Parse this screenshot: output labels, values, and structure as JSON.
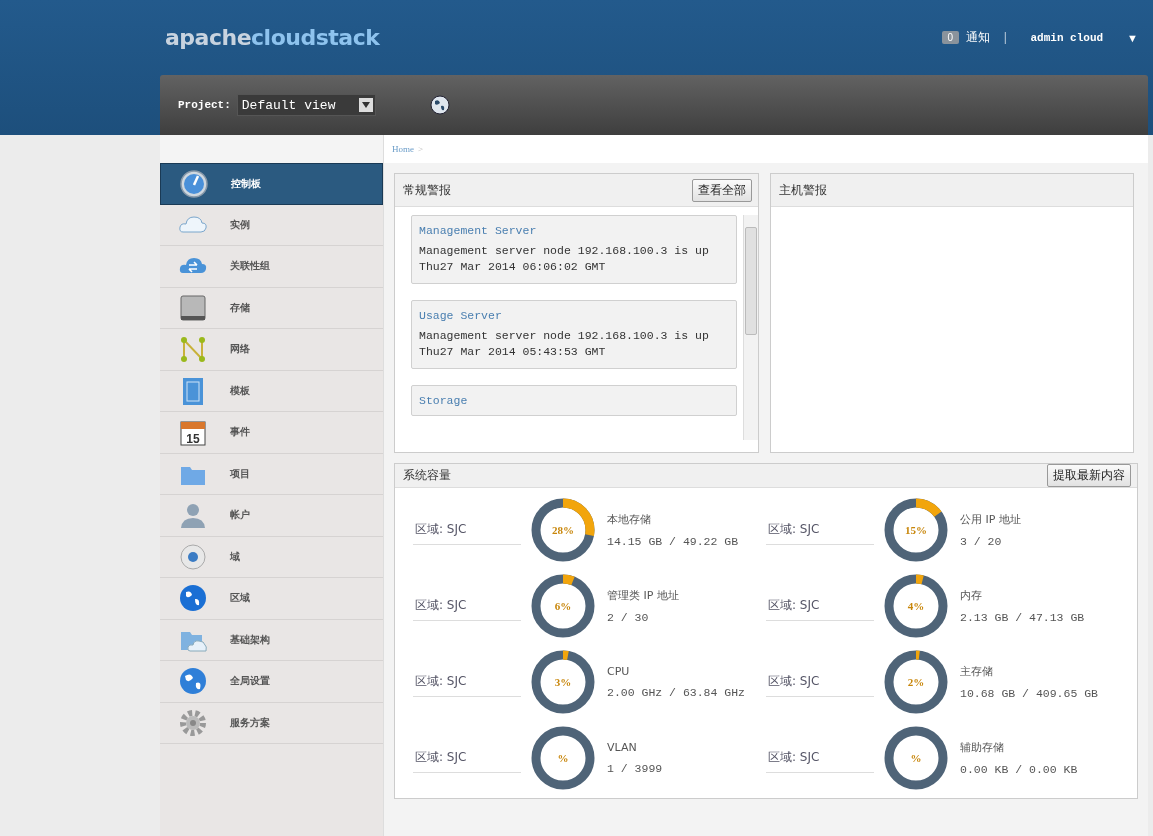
{
  "header": {
    "logo_prefix": "apache",
    "logo_suffix": "cloudstack",
    "notification_count": "0",
    "notification_label": "通知",
    "separator": "|",
    "user": "admin cloud",
    "user_menu_caret": "▼"
  },
  "project_bar": {
    "label": "Project:",
    "value": "Default view"
  },
  "sidebar": {
    "items": [
      {
        "label": "控制板",
        "selected": true
      },
      {
        "label": "实例",
        "selected": false
      },
      {
        "label": "关联性组",
        "selected": false
      },
      {
        "label": "存储",
        "selected": false
      },
      {
        "label": "网络",
        "selected": false
      },
      {
        "label": "模板",
        "selected": false
      },
      {
        "label": "事件",
        "selected": false,
        "icon_text": "15"
      },
      {
        "label": "项目",
        "selected": false
      },
      {
        "label": "帐户",
        "selected": false
      },
      {
        "label": "域",
        "selected": false
      },
      {
        "label": "区域",
        "selected": false
      },
      {
        "label": "基础架构",
        "selected": false
      },
      {
        "label": "全局设置",
        "selected": false
      },
      {
        "label": "服务方案",
        "selected": false
      }
    ]
  },
  "breadcrumb": {
    "home": "Home",
    "separator": ">"
  },
  "general_alerts": {
    "title": "常规警报",
    "button": "查看全部",
    "alerts": [
      {
        "title": "Management Server",
        "message": "Management server node 192.168.100.3 is up",
        "time": "Thu27 Mar 2014 06:06:02 GMT"
      },
      {
        "title": "Usage Server",
        "message": "Management server node 192.168.100.3 is up",
        "time": "Thu27 Mar 2014 05:43:53 GMT"
      },
      {
        "title": "Storage"
      }
    ]
  },
  "host_alerts": {
    "title": "主机警报"
  },
  "capacity": {
    "title": "系统容量",
    "button": "提取最新内容",
    "items": [
      {
        "zone": "区域: SJC",
        "percent": "28%",
        "level": 0.28,
        "name": "本地存储",
        "usage": "14.15 GB / 49.22 GB"
      },
      {
        "zone": "区域: SJC",
        "percent": "15%",
        "level": 0.15,
        "name": "公用 IP 地址",
        "usage": "3 / 20"
      },
      {
        "zone": "区域: SJC",
        "percent": "6%",
        "level": 0.06,
        "name": "管理类 IP 地址",
        "usage": "2 / 30"
      },
      {
        "zone": "区域: SJC",
        "percent": "4%",
        "level": 0.04,
        "name": "内存",
        "usage": "2.13 GB / 47.13 GB"
      },
      {
        "zone": "区域: SJC",
        "percent": "3%",
        "level": 0.03,
        "name": "CPU",
        "usage": "2.00 GHz / 63.84 GHz"
      },
      {
        "zone": "区域: SJC",
        "percent": "2%",
        "level": 0.02,
        "name": "主存储",
        "usage": "10.68 GB / 409.65 GB"
      },
      {
        "zone": "区域: SJC",
        "percent": "%",
        "level": 0,
        "name": "VLAN",
        "usage": "1 / 3999"
      },
      {
        "zone": "区域: SJC",
        "percent": "%",
        "level": 0,
        "name": "辅助存储",
        "usage": "0.00 KB / 0.00 KB"
      }
    ]
  }
}
